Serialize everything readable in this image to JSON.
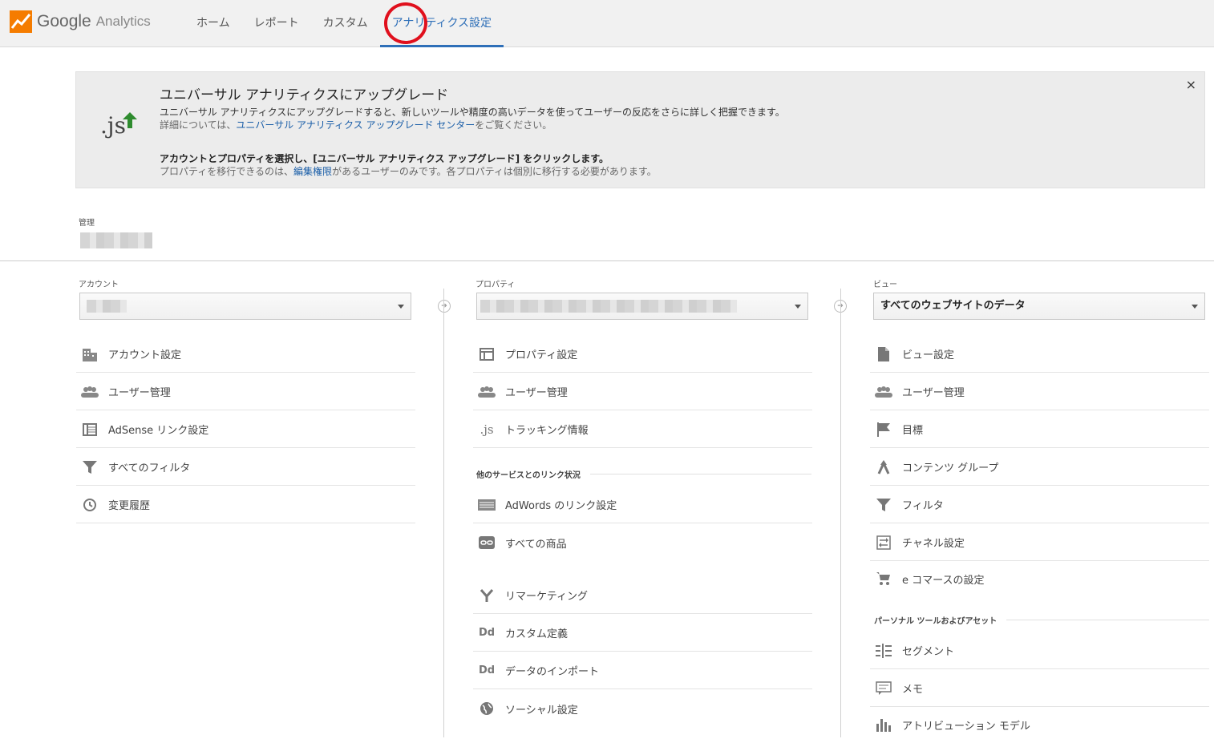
{
  "header": {
    "logo_google": "Google",
    "logo_analytics": "Analytics",
    "nav": [
      "ホーム",
      "レポート",
      "カスタム",
      "アナリティクス設定"
    ]
  },
  "banner": {
    "icon": ".js",
    "title": "ユニバーサル アナリティクスにアップグレード",
    "line1": "ユニバーサル アナリティクスにアップグレードすると、新しいツールや精度の高いデータを使ってユーザーの反応をさらに詳しく把握できます。",
    "line2_pre": "詳細については、",
    "line2_link": "ユニバーサル アナリティクス アップグレード センター",
    "line2_post": "をご覧ください。",
    "line3": "アカウントとプロパティを選択し、[ユニバーサル アナリティクス アップグレード] をクリックします。",
    "line4_pre": "プロパティを移行できるのは、",
    "line4_link": "編集権限",
    "line4_post": "があるユーザーのみです。各プロパティは個別に移行する必要があります。",
    "close": "×"
  },
  "admin": {
    "label": "管理"
  },
  "account": {
    "label": "アカウント",
    "items": [
      {
        "icon": "building-icon",
        "label": "アカウント設定"
      },
      {
        "icon": "users-icon",
        "label": "ユーザー管理"
      },
      {
        "icon": "table-icon",
        "label": "AdSense リンク設定"
      },
      {
        "icon": "filter-icon",
        "label": "すべてのフィルタ"
      },
      {
        "icon": "history-icon",
        "label": "変更履歴"
      }
    ]
  },
  "property": {
    "label": "プロパティ",
    "items": [
      {
        "icon": "window-icon",
        "label": "プロパティ設定"
      },
      {
        "icon": "users-icon",
        "label": "ユーザー管理"
      },
      {
        "icon": "js-icon",
        "label": "トラッキング情報"
      }
    ],
    "section": "他のサービスとのリンク状況",
    "linked": [
      {
        "icon": "adwords-icon",
        "label": "AdWords のリンク設定"
      },
      {
        "icon": "link-icon",
        "label": "すべての商品"
      },
      {
        "icon": "remarketing-icon",
        "label": "リマーケティング"
      },
      {
        "icon": "dd-icon",
        "label": "カスタム定義"
      },
      {
        "icon": "dd-icon",
        "label": "データのインポート"
      },
      {
        "icon": "globe-icon",
        "label": "ソーシャル設定"
      }
    ]
  },
  "view": {
    "label": "ビュー",
    "selected": "すべてのウェブサイトのデータ",
    "items": [
      {
        "icon": "document-icon",
        "label": "ビュー設定"
      },
      {
        "icon": "users-icon",
        "label": "ユーザー管理"
      },
      {
        "icon": "flag-icon",
        "label": "目標"
      },
      {
        "icon": "content-group-icon",
        "label": "コンテンツ グループ"
      },
      {
        "icon": "filter-icon",
        "label": "フィルタ"
      },
      {
        "icon": "channel-icon",
        "label": "チャネル設定"
      },
      {
        "icon": "cart-icon",
        "label": "e コマースの設定"
      }
    ],
    "section": "パーソナル ツールおよびアセット",
    "personal": [
      {
        "icon": "segment-icon",
        "label": "セグメント"
      },
      {
        "icon": "memo-icon",
        "label": "メモ"
      },
      {
        "icon": "attribution-icon",
        "label": "アトリビューション モデル"
      }
    ]
  },
  "colors": {
    "accent": "#2e6fb8",
    "logo": "#f57c00",
    "highlight_circle": "#e0101d"
  }
}
